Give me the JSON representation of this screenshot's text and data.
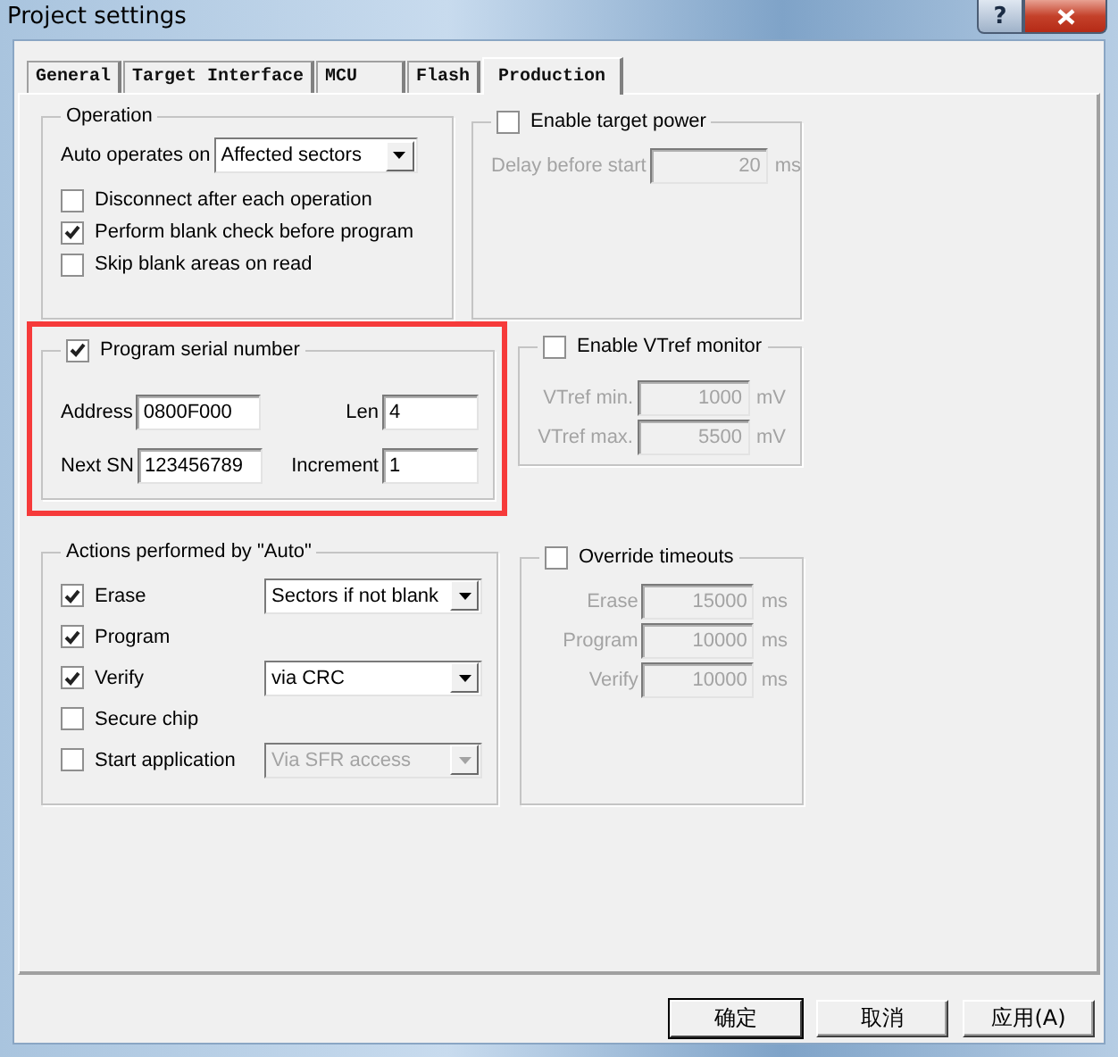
{
  "window": {
    "title": "Project settings",
    "help": "?"
  },
  "tabs": [
    {
      "label": "General",
      "selected": false
    },
    {
      "label": "Target Interface",
      "selected": false
    },
    {
      "label": "MCU",
      "selected": false
    },
    {
      "label": "Flash",
      "selected": false
    },
    {
      "label": "Production",
      "selected": true
    }
  ],
  "operation": {
    "title": "Operation",
    "auto_operates": {
      "label": "Auto operates on",
      "value": "Affected sectors"
    },
    "options": [
      {
        "label": "Disconnect after each operation",
        "checked": false
      },
      {
        "label": "Perform blank check before program",
        "checked": true
      },
      {
        "label": "Skip blank areas on read",
        "checked": false
      }
    ]
  },
  "target_power": {
    "label": "Enable target power",
    "checked": false,
    "fields": [
      {
        "label": "Delay before start",
        "value": "20",
        "unit": "ms"
      }
    ]
  },
  "serial_number": {
    "label": "Program serial number",
    "checked": true,
    "highlighted": true,
    "fields": [
      {
        "label": "Address",
        "value": "0800F000"
      },
      {
        "label": "Len",
        "value": "4"
      },
      {
        "label": "Next SN",
        "value": "123456789"
      },
      {
        "label": "Increment",
        "value": "1"
      }
    ]
  },
  "vtref_monitor": {
    "label": "Enable VTref monitor",
    "checked": false,
    "fields": [
      {
        "label": "VTref min.",
        "value": "1000",
        "unit": "mV"
      },
      {
        "label": "VTref max.",
        "value": "5500",
        "unit": "mV"
      }
    ]
  },
  "auto_actions": {
    "title": "Actions performed by \"Auto\"",
    "items": [
      {
        "label": "Erase",
        "checked": true,
        "select": {
          "value": "Sectors if not blank",
          "disabled": false
        }
      },
      {
        "label": "Program",
        "checked": true
      },
      {
        "label": "Verify",
        "checked": true,
        "select": {
          "value": "via CRC",
          "disabled": false
        }
      },
      {
        "label": "Secure chip",
        "checked": false
      },
      {
        "label": "Start application",
        "checked": false,
        "select": {
          "value": "Via SFR access",
          "disabled": true
        }
      }
    ]
  },
  "timeouts": {
    "label": "Override timeouts",
    "checked": false,
    "fields": [
      {
        "label": "Erase",
        "value": "15000",
        "unit": "ms"
      },
      {
        "label": "Program",
        "value": "10000",
        "unit": "ms"
      },
      {
        "label": "Verify",
        "value": "10000",
        "unit": "ms"
      }
    ]
  },
  "buttons": [
    {
      "label": "确定",
      "default": true
    },
    {
      "label": "取消",
      "default": false
    },
    {
      "label": "应用(A)",
      "default": false
    }
  ]
}
